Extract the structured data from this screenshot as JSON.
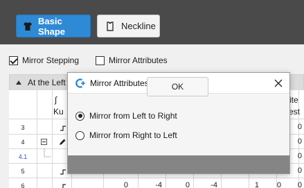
{
  "toolbar": {
    "basic_shape_label": "Basic Shape",
    "neckline_label": "Neckline",
    "active_color": "#2f8ad6"
  },
  "options": {
    "mirror_stepping_label": "Mirror Stepping",
    "mirror_stepping_checked": true,
    "mirror_attributes_label": "Mirror Attributes",
    "mirror_attributes_checked": false
  },
  "panel": {
    "title_fragment": "At the Left",
    "header_fragment": "Ku",
    "header_right_top": "ite",
    "header_right_bottom": "est"
  },
  "grid": {
    "rows": [
      {
        "num": "3",
        "icon": "step-icon",
        "blue": false,
        "right_value": "0"
      },
      {
        "num": "4",
        "icon": "edit-icon",
        "blue": false,
        "right_value": "0"
      },
      {
        "num": "4.1",
        "icon": "",
        "blue": true,
        "right_value": "0"
      },
      {
        "num": "5",
        "icon": "step-icon",
        "blue": false,
        "right_value": "0"
      },
      {
        "num": "6",
        "icon": "step-icon",
        "blue": false,
        "right_value": "0"
      }
    ],
    "bottom_row_values": [
      "0",
      "-4",
      "0",
      "-4",
      "1",
      "0",
      "0"
    ]
  },
  "dialog": {
    "title": "Mirror Attributes",
    "options": [
      {
        "label": "Mirror from Left to Right",
        "selected": true
      },
      {
        "label": "Mirror from Right to Left",
        "selected": false
      }
    ],
    "ok_label": "OK"
  }
}
